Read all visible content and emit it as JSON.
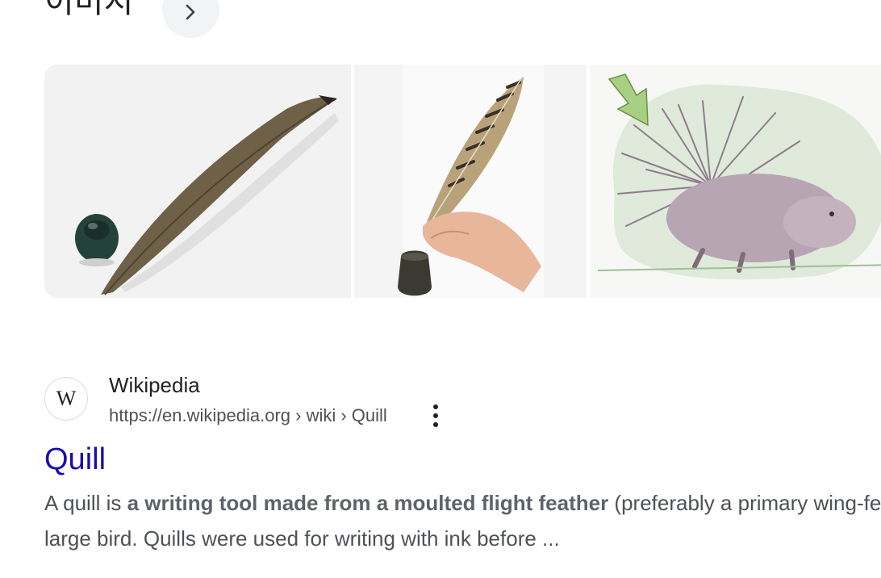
{
  "images_section": {
    "heading": "이미지",
    "more_button_icon": "chevron-right-icon",
    "thumbnails": [
      {
        "subject": "quill-with-inkwell",
        "colors": {
          "background": "#f2f2f2",
          "feather": "#6e6148",
          "inkwell": "#24423a"
        }
      },
      {
        "subject": "hand-holding-striped-feather",
        "colors": {
          "background": "#f4f4f4",
          "feather": "#b9a27a",
          "hand": "#e8b79b",
          "inkwell": "#3a3a32"
        }
      },
      {
        "subject": "porcupine-illustration",
        "colors": {
          "background": "#dfeadb",
          "quills": "#8f7d8a",
          "arrow": "#a9cf82"
        }
      }
    ]
  },
  "result": {
    "favicon_letter": "W",
    "site_name": "Wikipedia",
    "breadcrumb": "https://en.wikipedia.org › wiki › Quill",
    "more_options_icon": "three-dots-vertical-icon",
    "title": "Quill",
    "snippet": {
      "part1": "A quill is ",
      "bold": "a writing tool made from a moulted flight feather",
      "part2": " (preferably a primary wing-feather) of a",
      "line2": "large bird. Quills were used for writing with ink before ..."
    }
  },
  "colors": {
    "title_link": "#1a0dab",
    "text": "#202124",
    "muted": "#4d5156",
    "button_bg": "#f1f3f4"
  }
}
